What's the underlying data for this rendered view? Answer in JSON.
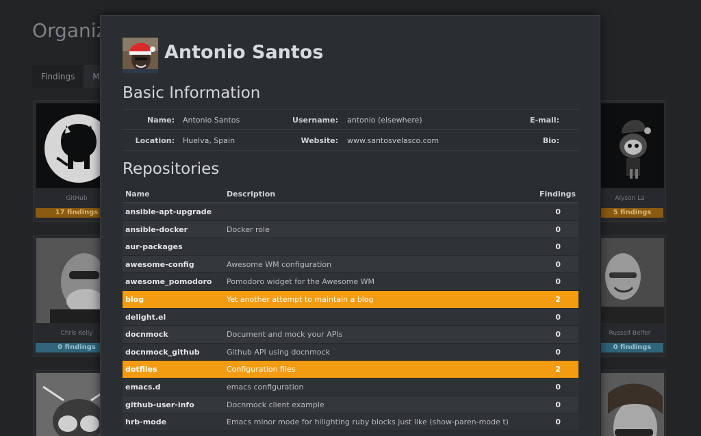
{
  "background": {
    "title": "Organiz",
    "tabs": [
      {
        "label": "Findings"
      },
      {
        "label": "Me"
      }
    ],
    "cards": [
      {
        "name": "GitHub",
        "badge": "17 findings",
        "badge_color": "orange"
      },
      {
        "name": "Alyson La",
        "badge": "5 findings",
        "badge_color": "orange"
      },
      {
        "name": "Chris Kelly",
        "badge": "0 findings",
        "badge_color": "blue"
      },
      {
        "name": "Russell Belfer",
        "badge": "0 findings",
        "badge_color": "blue"
      }
    ]
  },
  "profile": {
    "name": "Antonio Santos"
  },
  "basic_info": {
    "title": "Basic Information",
    "name_label": "Name:",
    "name_value": "Antonio Santos",
    "username_label": "Username:",
    "username_value": "antonio (elsewhere)",
    "email_label": "E-mail:",
    "location_label": "Location:",
    "location_value": "Huelva, Spain",
    "website_label": "Website:",
    "website_value": "www.santosvelasco.com",
    "bio_label": "Bio:"
  },
  "repositories": {
    "title": "Repositories",
    "headers": {
      "name": "Name",
      "description": "Description",
      "findings": "Findings"
    },
    "rows": [
      {
        "name": "ansible-apt-upgrade",
        "description": "",
        "findings": "0",
        "highlight": false
      },
      {
        "name": "ansible-docker",
        "description": "Docker role",
        "findings": "0",
        "highlight": false
      },
      {
        "name": "aur-packages",
        "description": "",
        "findings": "0",
        "highlight": false
      },
      {
        "name": "awesome-config",
        "description": "Awesome WM configuration",
        "findings": "0",
        "highlight": false
      },
      {
        "name": "awesome_pomodoro",
        "description": "Pomodoro widget for the Awesome WM",
        "findings": "0",
        "highlight": false
      },
      {
        "name": "blog",
        "description": "Yet another attempt to maintain a blog",
        "findings": "2",
        "highlight": true
      },
      {
        "name": "delight.el",
        "description": "",
        "findings": "0",
        "highlight": false
      },
      {
        "name": "docnmock",
        "description": "Document and mock your APIs",
        "findings": "0",
        "highlight": false
      },
      {
        "name": "docnmock_github",
        "description": "Github API using docnmock",
        "findings": "0",
        "highlight": false
      },
      {
        "name": "dotfiles",
        "description": "Configuration files",
        "findings": "2",
        "highlight": true
      },
      {
        "name": "emacs.d",
        "description": "emacs configuration",
        "findings": "0",
        "highlight": false
      },
      {
        "name": "github-user-info",
        "description": "Docnmock client example",
        "findings": "0",
        "highlight": false
      },
      {
        "name": "hrb-mode",
        "description": "Emacs minor mode for hilighting ruby blocks just like (show-paren-mode t)",
        "findings": "0",
        "highlight": false
      }
    ]
  },
  "colors": {
    "highlight": "#f39c12",
    "modal_bg": "#2b2e31",
    "page_bg": "#1b1c1e"
  }
}
